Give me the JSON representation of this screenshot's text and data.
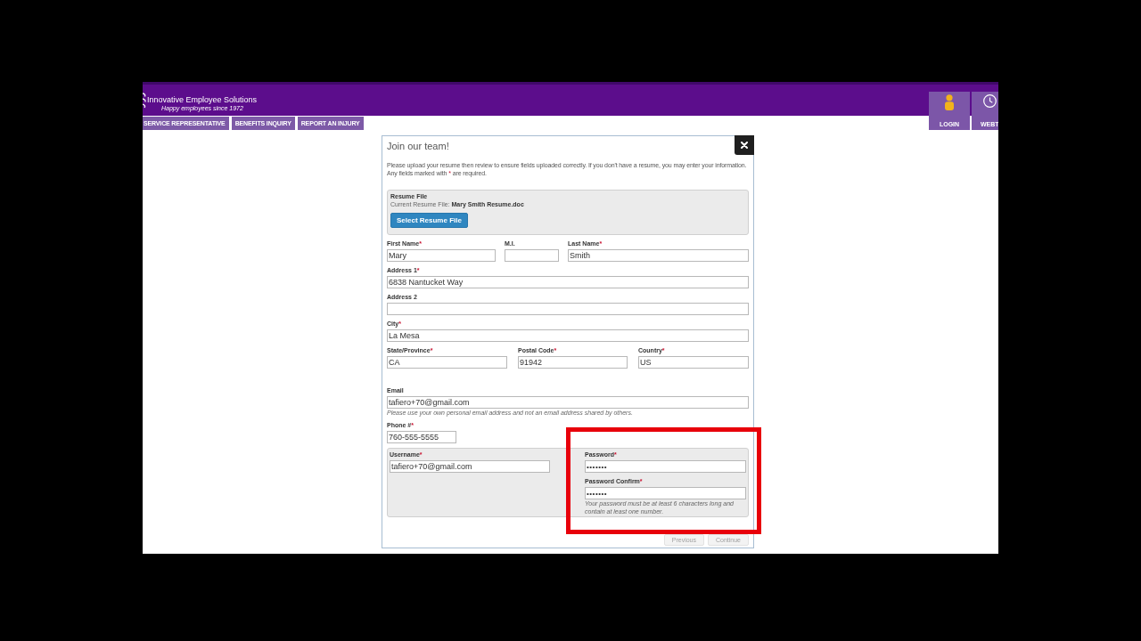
{
  "header": {
    "brand": "Innovative Employee Solutions",
    "tagline": "Happy employees since 1972",
    "nav": [
      "SERVICE REPRESENTATIVE",
      "BENEFITS INQUIRY",
      "REPORT AN INJURY"
    ],
    "actions": [
      "LOGIN",
      "WEBT"
    ]
  },
  "dialog": {
    "title": "Join our team!",
    "intro": "Please upload your resume then review to ensure fields uploaded correctly. If you don't have a resume, you may enter your information.",
    "required_note": {
      "before": "Any fields marked with ",
      "required_mark": "*",
      "after": " are required."
    },
    "resume": {
      "heading": "Resume File",
      "current": "Current Resume File: **Mary Smith Resume.doc**",
      "button": "Select Resume File"
    },
    "name_row": [
      {
        "label": "First Name",
        "required_mark": "*",
        "value": "Mary"
      },
      {
        "label": "M.I."
      },
      {
        "label": "Last Name",
        "required_mark": "*",
        "value": "Smith"
      }
    ],
    "address_fields": [
      {
        "label": "Address 1",
        "required_mark": "*",
        "value": "6838 Nantucket Way"
      },
      {
        "label": "Address 2"
      },
      {
        "label": "City",
        "required_mark": "*",
        "value": "La Mesa"
      }
    ],
    "region_row": [
      {
        "label": "State/Province",
        "required_mark": "*",
        "value": "CA"
      },
      {
        "label": "Postal Code",
        "required_mark": "*",
        "value": "91942"
      },
      {
        "label": "Country",
        "required_mark": "*",
        "value": "US"
      }
    ],
    "email": {
      "label": "Email",
      "value": "tafiero+70@gmail.com",
      "hint": "Please use your own personal email address and not an email address shared by others."
    },
    "phone": {
      "label": "Phone #",
      "required_mark": "*",
      "value": "760-555-5555"
    },
    "credentials": {
      "username": {
        "label": "Username",
        "required_mark": "*",
        "value": "tafiero+70@gmail.com"
      },
      "password": {
        "label": "Password",
        "required_mark": "*",
        "value": "•••••••"
      },
      "password_confirm": {
        "label": "Password Confirm",
        "required_mark": "*",
        "value": "•••••••"
      },
      "hint": "Your password must be at least 6 characters long and contain at least one number."
    },
    "buttons": [
      {
        "label": "Previous",
        "disabled": true
      },
      {
        "label": "Continue",
        "disabled": true
      }
    ]
  }
}
